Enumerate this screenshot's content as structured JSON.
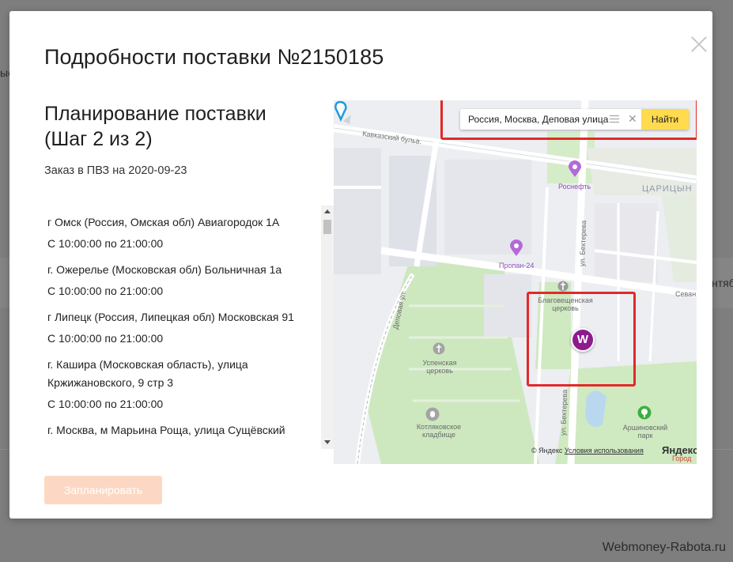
{
  "background": {
    "left_fragment": "ые",
    "right_fragment": "нтяб"
  },
  "modal": {
    "title": "Подробности поставки №2150185",
    "close_label": "×"
  },
  "planning": {
    "step_title": "Планирование поставки (Шаг 2 из 2)",
    "order_info": "Заказ в ПВЗ на 2020-09-23"
  },
  "pickup_points": [
    {
      "address": "г Омск (Россия, Омская обл) Авиагородок 1А",
      "hours": "С 10:00:00 по 21:00:00"
    },
    {
      "address": "г. Ожерелье (Московская обл) Больничная 1а",
      "hours": "С 10:00:00 по 21:00:00"
    },
    {
      "address": "г Липецк (Россия, Липецкая обл) Московская 91",
      "hours": "С 10:00:00 по 21:00:00"
    },
    {
      "address": "г. Кашира (Московская область), улица Кржижановского, 9 стр 3",
      "hours": "С 10:00:00 по 21:00:00"
    },
    {
      "address": "г. Москва, м Марьина Роща, улица Сущёвский",
      "hours": ""
    }
  ],
  "actions": {
    "plan_button": "Запланировать"
  },
  "map": {
    "search_value": "Россия, Москва, Деповая улица",
    "search_button": "Найти",
    "marker_letter": "W",
    "labels": {
      "boulevard": "Кавказский бульв.",
      "depovaya": "Деповая ул.",
      "bekhtereva_top": "ул. Бехтерева",
      "bekhtereva_bottom": "ул. Бехтерева",
      "rosneft": "Роснефть",
      "propan": "Пропан-24",
      "tsaritsyno": "ЦАРИЦЫН",
      "sevan": "Севан",
      "church_blag_1": "Благовещенская",
      "church_blag_2": "церковь",
      "church_usp_1": "Успенская",
      "church_usp_2": "церковь",
      "cemetery_1": "Котляковское",
      "cemetery_2": "кладбище",
      "park_1": "Аршиновский",
      "park_2": "парк",
      "gorod": "Город"
    },
    "copyright": "© Яндекс",
    "terms": "Условия использования",
    "logo_main": "Яндекс"
  },
  "watermark": "Webmoney-Rabota.ru",
  "colors": {
    "accent_disabled": "#fcd8c4",
    "search_button": "#ffdb4d",
    "highlight_border": "#e02a2a",
    "marker_purple": "#8e1b8e",
    "map_green": "#c8e6b8"
  }
}
